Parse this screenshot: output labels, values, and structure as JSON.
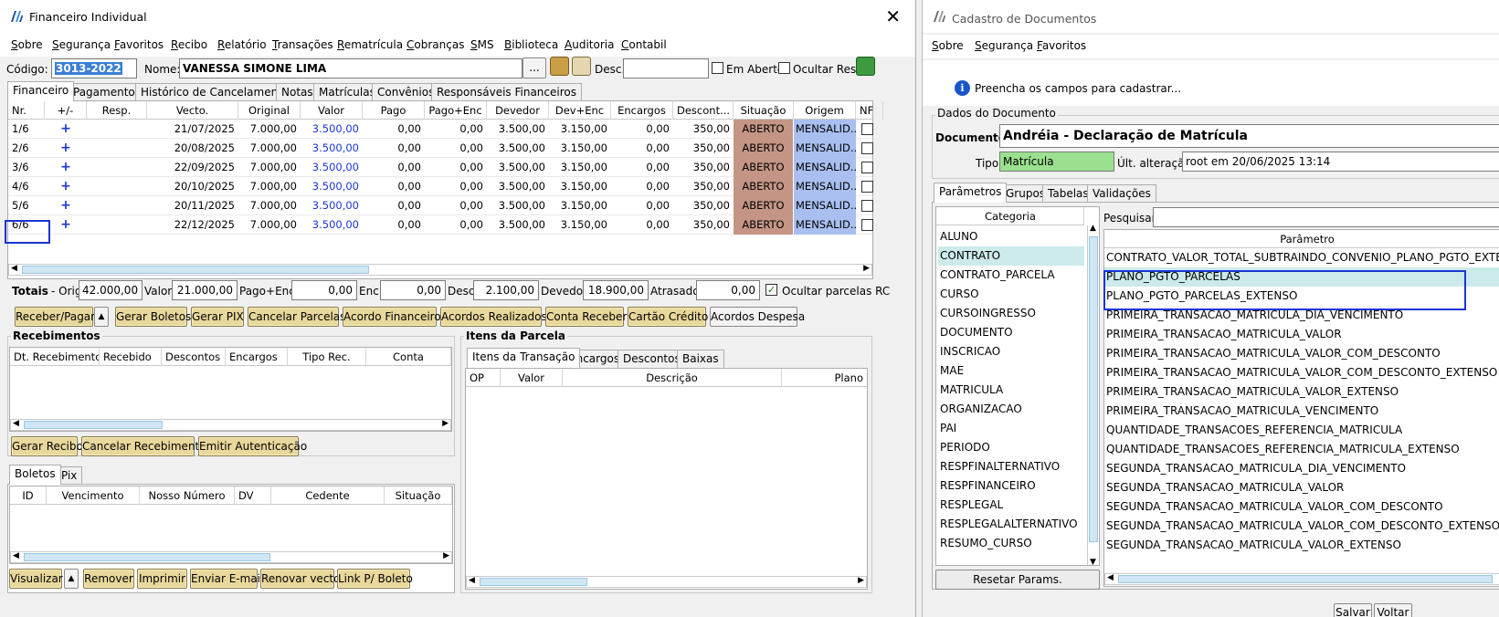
{
  "left": {
    "title": "Financeiro Individual",
    "menu": [
      "Sobre",
      "Segurança",
      "Favoritos",
      "Recibo",
      "Relatório",
      "Transações",
      "Rematrícula",
      "Cobranças",
      "SMS",
      "Biblioteca",
      "Auditoria",
      "Contabil"
    ],
    "codigo_label": "Código:",
    "codigo_value": "3013-2022",
    "nome_label": "Nome:",
    "nome_value": "VANESSA SIMONE LIMA",
    "ellipsis": "...",
    "desc_label": "Desc.:",
    "desc_value": "",
    "em_aberto_label": "Em Aberto",
    "ocultar_resp_label": "Ocultar Resp.",
    "tabs": [
      "Financeiro",
      "Pagamentos",
      "Histórico de Cancelamentos",
      "Notas",
      "Matrículas",
      "Convênios",
      "Responsáveis Financeiros"
    ],
    "grid_headers": [
      "Nr.",
      "+/-",
      "Resp.",
      "Vecto.",
      "Original",
      "Valor",
      "Pago",
      "Pago+Enc",
      "Devedor",
      "Dev+Enc",
      "Encargos",
      "Descont...",
      "Situação",
      "Origem",
      "NF"
    ],
    "rows": [
      {
        "nr": "1/6",
        "pm": "+",
        "resp": "",
        "vecto": "21/07/2025",
        "original": "7.000,00",
        "valor": "3.500,00",
        "pago": "0,00",
        "pagoenc": "0,00",
        "devedor": "3.500,00",
        "devenc": "3.150,00",
        "encargos": "0,00",
        "descont": "350,00",
        "situacao": "ABERTO",
        "origem": "MENSALID..."
      },
      {
        "nr": "2/6",
        "pm": "+",
        "resp": "",
        "vecto": "20/08/2025",
        "original": "7.000,00",
        "valor": "3.500,00",
        "pago": "0,00",
        "pagoenc": "0,00",
        "devedor": "3.500,00",
        "devenc": "3.150,00",
        "encargos": "0,00",
        "descont": "350,00",
        "situacao": "ABERTO",
        "origem": "MENSALID..."
      },
      {
        "nr": "3/6",
        "pm": "+",
        "resp": "",
        "vecto": "22/09/2025",
        "original": "7.000,00",
        "valor": "3.500,00",
        "pago": "0,00",
        "pagoenc": "0,00",
        "devedor": "3.500,00",
        "devenc": "3.150,00",
        "encargos": "0,00",
        "descont": "350,00",
        "situacao": "ABERTO",
        "origem": "MENSALID..."
      },
      {
        "nr": "4/6",
        "pm": "+",
        "resp": "",
        "vecto": "20/10/2025",
        "original": "7.000,00",
        "valor": "3.500,00",
        "pago": "0,00",
        "pagoenc": "0,00",
        "devedor": "3.500,00",
        "devenc": "3.150,00",
        "encargos": "0,00",
        "descont": "350,00",
        "situacao": "ABERTO",
        "origem": "MENSALID..."
      },
      {
        "nr": "5/6",
        "pm": "+",
        "resp": "",
        "vecto": "20/11/2025",
        "original": "7.000,00",
        "valor": "3.500,00",
        "pago": "0,00",
        "pagoenc": "0,00",
        "devedor": "3.500,00",
        "devenc": "3.150,00",
        "encargos": "0,00",
        "descont": "350,00",
        "situacao": "ABERTO",
        "origem": "MENSALID..."
      },
      {
        "nr": "6/6",
        "pm": "+",
        "resp": "",
        "vecto": "22/12/2025",
        "original": "7.000,00",
        "valor": "3.500,00",
        "pago": "0,00",
        "pagoenc": "0,00",
        "devedor": "3.500,00",
        "devenc": "3.150,00",
        "encargos": "0,00",
        "descont": "350,00",
        "situacao": "ABERTO",
        "origem": "MENSALID..."
      }
    ],
    "totals": {
      "label": "Totais",
      "orig_label": "- Orig:",
      "orig": "42.000,00",
      "valor_label": "Valor:",
      "valor": "21.000,00",
      "pagoenc_label": "Pago+Enc:",
      "pagoenc": "0,00",
      "enc_label": "Enc:",
      "enc": "0,00",
      "desc_label": "Desc:",
      "desc": "2.100,00",
      "devedor_label": "Devedor:",
      "devedor": "18.900,00",
      "atrasado_label": "Atrasado:",
      "atrasado": "0,00",
      "ocultar_label": "Ocultar parcelas RC"
    },
    "action_buttons": [
      "Receber/Pagar",
      "Gerar Boletos",
      "Gerar PIX",
      "Cancelar Parcelas",
      "Acordo Financeiro",
      "Acordos Realizados",
      "Conta Receber",
      "Cartão Crédito",
      "Acordos Despesa"
    ],
    "recebimentos": {
      "title": "Recebimentos",
      "headers": [
        "Dt. Recebimento",
        "Recebido",
        "Descontos",
        "Encargos",
        "Tipo Rec.",
        "Conta"
      ],
      "buttons": [
        "Gerar Recibo",
        "Cancelar Recebimento",
        "Emitir Autenticação"
      ]
    },
    "itens": {
      "title": "Itens da Parcela",
      "tabs": [
        "Itens da Transação",
        "Encargos",
        "Descontos",
        "Baixas"
      ],
      "headers": [
        "OP",
        "Valor",
        "Descrição",
        "Plano"
      ]
    },
    "boletos": {
      "tabs": [
        "Boletos",
        "Pix"
      ],
      "headers": [
        "ID",
        "Vencimento",
        "Nosso Número",
        "DV",
        "Cedente",
        "Situação"
      ],
      "buttons": [
        "Visualizar",
        "Remover",
        "Imprimir",
        "Enviar E-mail",
        "Renovar vecto",
        "Link P/ Boleto"
      ]
    }
  },
  "right": {
    "title": "Cadastro de Documentos",
    "menu": [
      "Sobre",
      "Segurança",
      "Favoritos"
    ],
    "info": "Preencha os campos para cadastrar...",
    "dados_title": "Dados do Documento",
    "documento_label": "Documento:",
    "documento_value": "Andréia - Declaração de Matrícula",
    "tipo_label": "Tipo:",
    "tipo_value": "Matrícula",
    "ult_label": "Últ. alteração:",
    "ult_value": "root em 20/06/2025 13:14",
    "tabs": [
      "Parâmetros",
      "Grupos",
      "Tabelas",
      "Validações"
    ],
    "categoria_header": "Categoria",
    "categorias": [
      "ALUNO",
      "CONTRATO",
      "CONTRATO_PARCELA",
      "CURSO",
      "CURSOINGRESSO",
      "DOCUMENTO",
      "INSCRICAO",
      "MAE",
      "MATRICULA",
      "ORGANIZACAO",
      "PAI",
      "PERIODO",
      "RESPFINALTERNATIVO",
      "RESPFINANCEIRO",
      "RESPLEGAL",
      "RESPLEGALALTERNATIVO",
      "RESUMO_CURSO"
    ],
    "selected_categoria": "CONTRATO",
    "pesquisar_label": "Pesquisar:",
    "parametro_header": "Parâmetro",
    "parametros": [
      "CONTRATO_VALOR_TOTAL_SUBTRAINDO_CONVENIO_PLANO_PGTO_EXTENSO",
      "PLANO_PGTO_PARCELAS",
      "PLANO_PGTO_PARCELAS_EXTENSO",
      "PRIMEIRA_TRANSACAO_MATRICULA_DIA_VENCIMENTO",
      "PRIMEIRA_TRANSACAO_MATRICULA_VALOR",
      "PRIMEIRA_TRANSACAO_MATRICULA_VALOR_COM_DESCONTO",
      "PRIMEIRA_TRANSACAO_MATRICULA_VALOR_COM_DESCONTO_EXTENSO",
      "PRIMEIRA_TRANSACAO_MATRICULA_VALOR_EXTENSO",
      "PRIMEIRA_TRANSACAO_MATRICULA_VENCIMENTO",
      "QUANTIDADE_TRANSACOES_REFERENCIA_MATRICULA",
      "QUANTIDADE_TRANSACOES_REFERENCIA_MATRICULA_EXTENSO",
      "SEGUNDA_TRANSACAO_MATRICULA_DIA_VENCIMENTO",
      "SEGUNDA_TRANSACAO_MATRICULA_VALOR",
      "SEGUNDA_TRANSACAO_MATRICULA_VALOR_COM_DESCONTO",
      "SEGUNDA_TRANSACAO_MATRICULA_VALOR_COM_DESCONTO_EXTENSO",
      "SEGUNDA_TRANSACAO_MATRICULA_VALOR_EXTENSO"
    ],
    "resetar_label": "Resetar Params.",
    "salvar_label": "Salvar",
    "voltar_label": "Voltar"
  },
  "colors": {
    "situacao_bg": "#c49585",
    "origem_bg": "#a8bff0",
    "highlight_border": "#1a35d6",
    "selected_row": "#cdeaea",
    "tipo_bg": "#9be08e",
    "code_highlight": "#3b7fd4",
    "valor_text": "#1a36d6"
  }
}
